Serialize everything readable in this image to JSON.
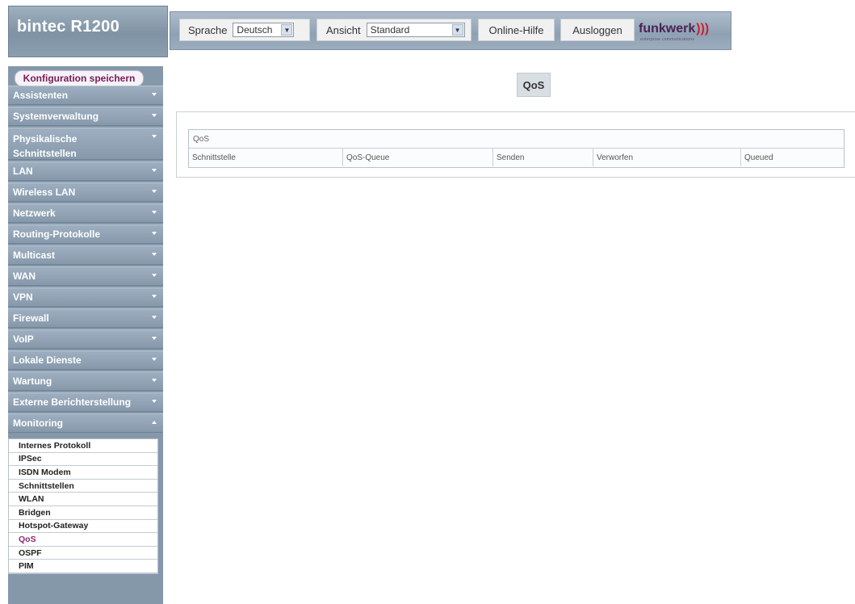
{
  "header": {
    "product": "bintec R1200",
    "language_label": "Sprache",
    "language_value": "Deutsch",
    "view_label": "Ansicht",
    "view_value": "Standard",
    "help_label": "Online-Hilfe",
    "logout_label": "Ausloggen",
    "brand": "funkwerk",
    "brand_waves": ")))",
    "brand_tagline": "enterprise communications"
  },
  "sidebar": {
    "save_label": "Konfiguration speichern",
    "items": [
      {
        "label": "Assistenten"
      },
      {
        "label": "Systemverwaltung"
      },
      {
        "label": "Physikalische Schnittstellen"
      },
      {
        "label": "LAN"
      },
      {
        "label": "Wireless LAN"
      },
      {
        "label": "Netzwerk"
      },
      {
        "label": "Routing-Protokolle"
      },
      {
        "label": "Multicast"
      },
      {
        "label": "WAN"
      },
      {
        "label": "VPN"
      },
      {
        "label": "Firewall"
      },
      {
        "label": "VoIP"
      },
      {
        "label": "Lokale Dienste"
      },
      {
        "label": "Wartung"
      },
      {
        "label": "Externe Berichterstellung"
      },
      {
        "label": "Monitoring"
      }
    ],
    "submenu": [
      {
        "label": "Internes Protokoll"
      },
      {
        "label": "IPSec"
      },
      {
        "label": "ISDN Modem"
      },
      {
        "label": "Schnittstellen"
      },
      {
        "label": "WLAN"
      },
      {
        "label": "Bridgen"
      },
      {
        "label": "Hotspot-Gateway"
      },
      {
        "label": "QoS"
      },
      {
        "label": "OSPF"
      },
      {
        "label": "PIM"
      }
    ]
  },
  "main": {
    "page_title": "QoS",
    "table": {
      "title": "QoS",
      "columns": [
        "Schnittstelle",
        "QoS-Queue",
        "Senden",
        "Verworfen",
        "Queued"
      ]
    }
  },
  "colors": {
    "nav": "#8699ab",
    "header": "#8ea1b3",
    "active_sub": "#8a2a6d",
    "brand": "#4b2252"
  }
}
